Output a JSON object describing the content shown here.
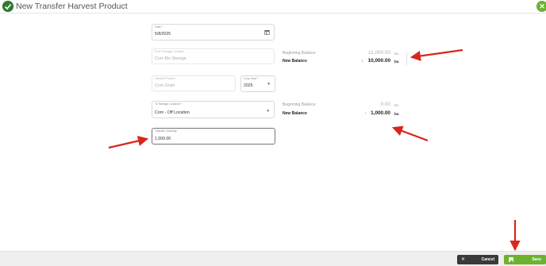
{
  "header": {
    "title": "New Transfer Harvest Product",
    "close_icon": "close-icon"
  },
  "form": {
    "date": {
      "label": "Date *",
      "value": "5/8/2025"
    },
    "from_storage": {
      "label": "From Storage Location",
      "value": "Corn Bin Storage"
    },
    "harvest_product": {
      "label": "Harvest Product",
      "value": "Corn Grain"
    },
    "crop_year": {
      "label": "Crop Year *",
      "value": "2025"
    },
    "to_storage": {
      "label": "To Storage Location *",
      "value": "Corn - Off Location"
    },
    "transfer_quantity": {
      "label": "Transfer Quantity",
      "value": "1,000.00"
    }
  },
  "from_balance": {
    "beginning_label": "Beginning Balance",
    "beginning_value": "11,000.00",
    "beginning_unit": "bu",
    "new_label": "New Balance",
    "new_value": "10,000.00",
    "new_unit": "bu",
    "direction_icon": "arrow-down-icon"
  },
  "to_balance": {
    "beginning_label": "Beginning Balance",
    "beginning_value": "0.00",
    "beginning_unit": "bu",
    "new_label": "New Balance",
    "new_value": "1,000.00",
    "new_unit": "bu",
    "direction_icon": "arrow-up-icon"
  },
  "footer": {
    "cancel_label": "Cancel",
    "save_label": "Save"
  },
  "colors": {
    "brand_green": "#6bb32e",
    "down_red": "#d63b2f",
    "annotation_red": "#d9261c"
  }
}
